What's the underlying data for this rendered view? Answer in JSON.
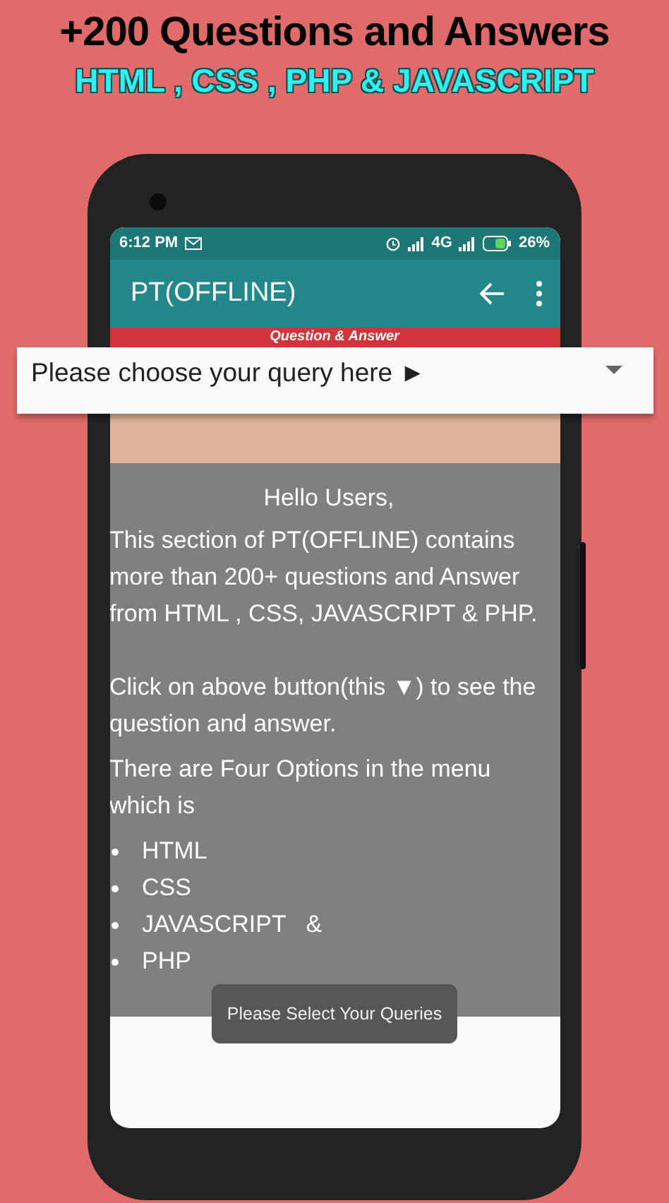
{
  "promo": {
    "title": "+200 Questions and Answers",
    "subtitle": "HTML , CSS , PHP & JAVASCRIPT"
  },
  "status_bar": {
    "time": "6:12 PM",
    "network": "4G",
    "battery": "26%"
  },
  "app_bar": {
    "title": "PT(OFFLINE)"
  },
  "banner": "Question & Answer",
  "dropdown": {
    "value": "Please choose your query here ►"
  },
  "content": {
    "greeting": "Hello Users,",
    "paragraphs": [
      "This section of PT(OFFLINE) contains more than 200+ questions and Answer from HTML , CSS, JAVASCRIPT & PHP.",
      "Click on above button(this ▼) to see the question and answer.",
      "There are Four Options in the menu which is"
    ],
    "list": [
      "HTML",
      "CSS",
      "JAVASCRIPT   &",
      "PHP"
    ]
  },
  "toast": "Please Select Your Queries"
}
